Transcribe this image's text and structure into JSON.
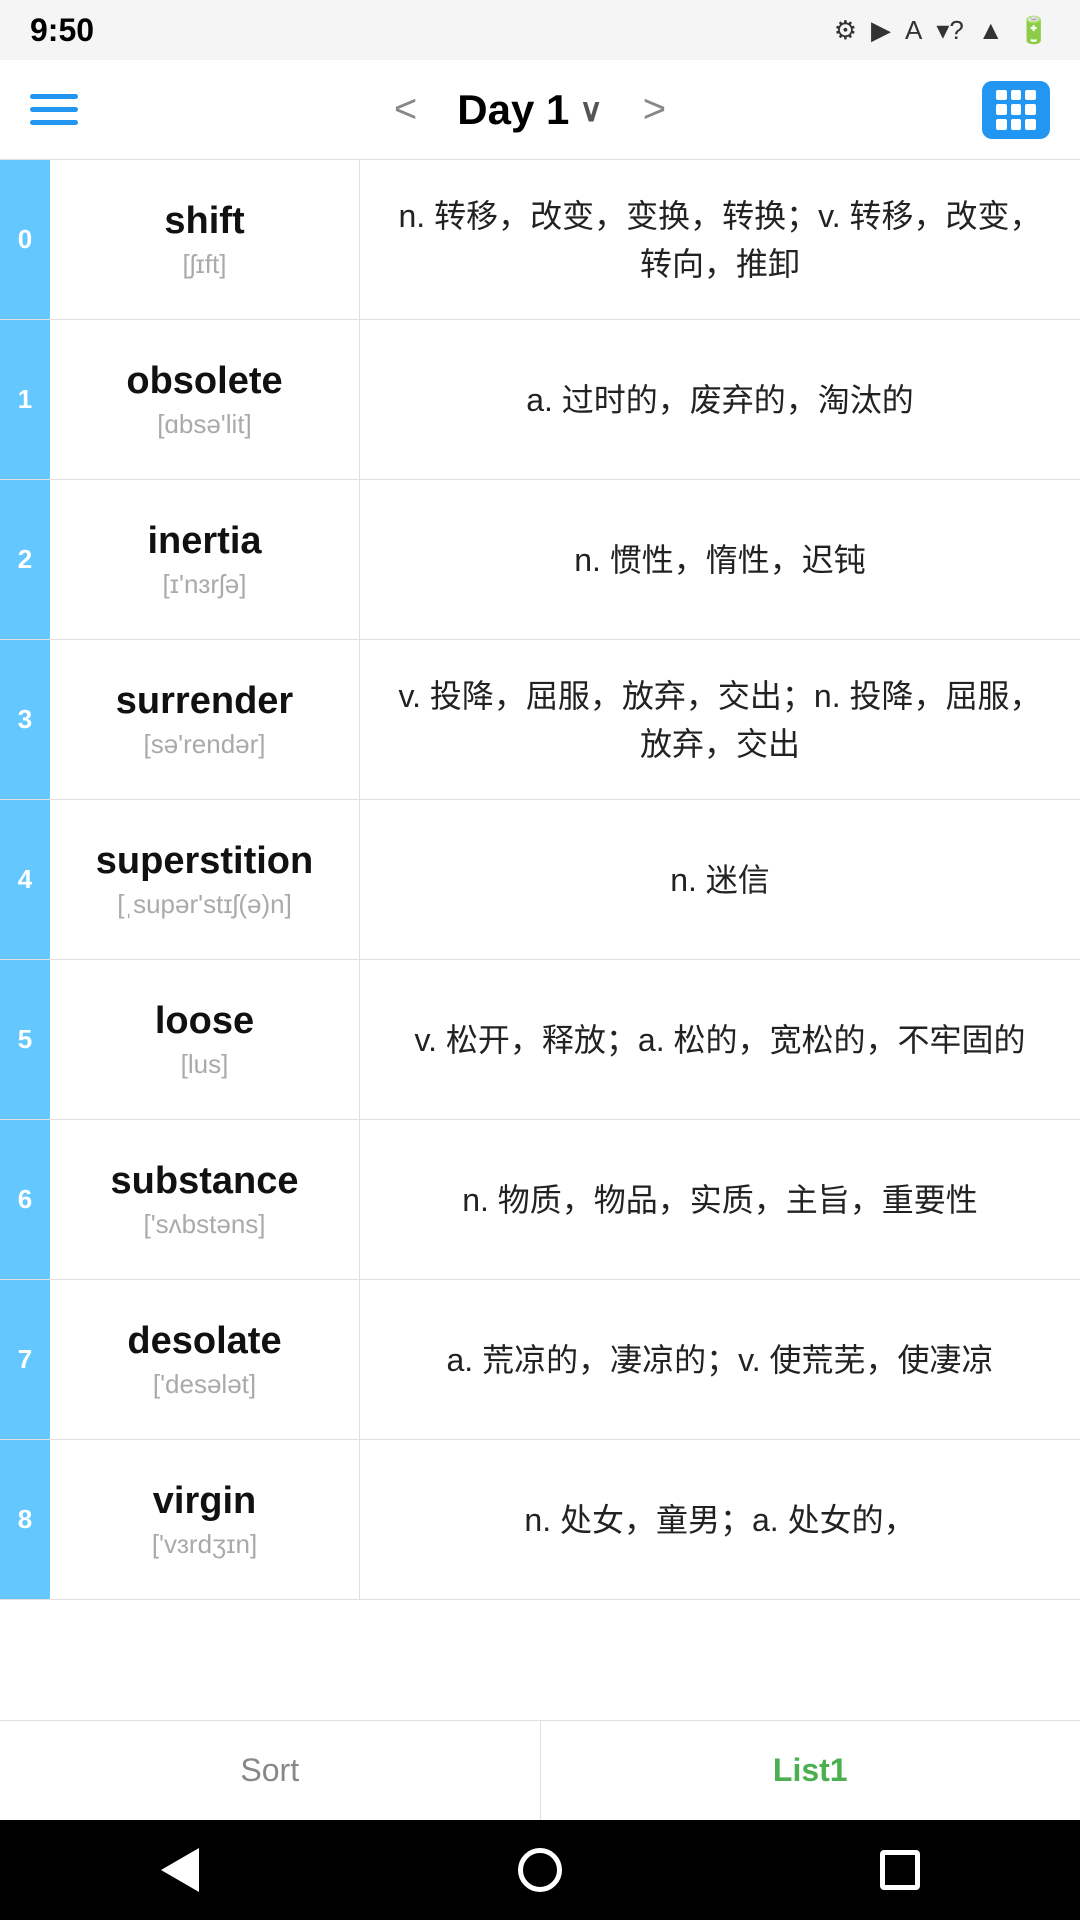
{
  "statusBar": {
    "time": "9:50",
    "icons": [
      "⚙",
      "▶",
      "A",
      "?",
      "•"
    ]
  },
  "toolbar": {
    "menuLabel": "menu",
    "prevLabel": "<",
    "title": "Day 1",
    "nextLabel": ">",
    "gridLabel": "grid-view"
  },
  "words": [
    {
      "index": "0",
      "word": "shift",
      "phonetic": "[ʃɪft]",
      "definition": "n. 转移，改变，变换，转换；v. 转移，改变，转向，推卸"
    },
    {
      "index": "1",
      "word": "obsolete",
      "phonetic": "[ɑbsə'lit]",
      "definition": "a. 过时的，废弃的，淘汰的"
    },
    {
      "index": "2",
      "word": "inertia",
      "phonetic": "[ɪ'nɜrʃə]",
      "definition": "n. 惯性，惰性，迟钝"
    },
    {
      "index": "3",
      "word": "surrender",
      "phonetic": "[sə'rendər]",
      "definition": "v. 投降，屈服，放弃，交出；n. 投降，屈服，放弃，交出"
    },
    {
      "index": "4",
      "word": "superstition",
      "phonetic": "[ˌsupər'stɪʃ(ə)n]",
      "definition": "n. 迷信"
    },
    {
      "index": "5",
      "word": "loose",
      "phonetic": "[lus]",
      "definition": "v. 松开，释放；a. 松的，宽松的，不牢固的"
    },
    {
      "index": "6",
      "word": "substance",
      "phonetic": "['sʌbstəns]",
      "definition": "n. 物质，物品，实质，主旨，重要性"
    },
    {
      "index": "7",
      "word": "desolate",
      "phonetic": "['desələt]",
      "definition": "a. 荒凉的，凄凉的；v. 使荒芜，使凄凉"
    },
    {
      "index": "8",
      "word": "virgin",
      "phonetic": "['vɜrdʒɪn]",
      "definition": "n. 处女，童男；a. 处女的，"
    }
  ],
  "bottomBar": {
    "sortLabel": "Sort",
    "list1Label": "List1"
  },
  "navBar": {
    "backLabel": "back",
    "homeLabel": "home",
    "recentsLabel": "recents"
  }
}
